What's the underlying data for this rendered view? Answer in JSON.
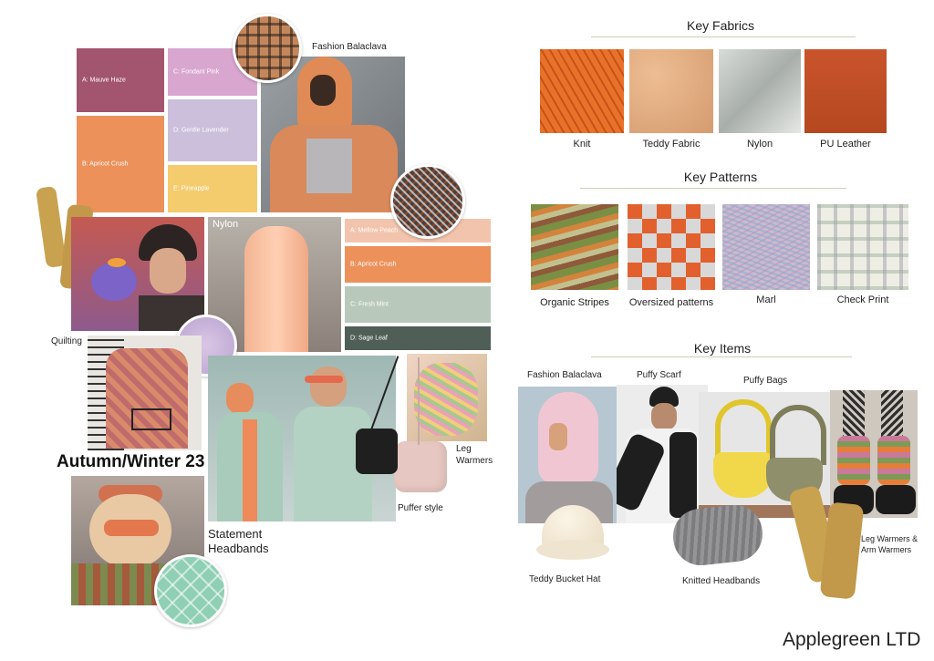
{
  "moodboard": {
    "title": "Autumn/Winter 23",
    "labels": {
      "balaclava": "Fashion Balaclava",
      "nylon": "Nylon",
      "quilting": "Quilting",
      "leg_warmers": "Leg\nWarmers",
      "puffer_style": "Puffer style",
      "statement_headbands": "Statement\nHeadbands"
    },
    "palette_left": [
      {
        "name": "A: Mauve Haze",
        "color": "#a3546f"
      },
      {
        "name": "B: Apricot Crush",
        "color": "#ec915a"
      },
      {
        "name": "C: Fondant Pink",
        "color": "#d9a6cf"
      },
      {
        "name": "D: Gentle Lavender",
        "color": "#cbbfdc"
      },
      {
        "name": "E: Pineapple",
        "color": "#f4cc6e"
      }
    ],
    "palette_right": [
      {
        "name": "A: Mellow Peach",
        "color": "#f2c4ad"
      },
      {
        "name": "B: Apricot Crush",
        "color": "#ec915a"
      },
      {
        "name": "C: Fresh Mint",
        "color": "#b8c9bb"
      },
      {
        "name": "D: Sage Leaf",
        "color": "#4f5f57"
      }
    ]
  },
  "key_fabrics": {
    "heading": "Key Fabrics",
    "items": [
      {
        "label": "Knit",
        "icon": "knit-texture"
      },
      {
        "label": "Teddy Fabric",
        "icon": "teddy-texture"
      },
      {
        "label": "Nylon",
        "icon": "nylon-texture"
      },
      {
        "label": "PU Leather",
        "icon": "leather-texture"
      }
    ]
  },
  "key_patterns": {
    "heading": "Key Patterns",
    "items": [
      {
        "label": "Organic Stripes"
      },
      {
        "label": "Oversized patterns"
      },
      {
        "label": "Marl"
      },
      {
        "label": "Check Print"
      }
    ]
  },
  "key_items": {
    "heading": "Key Items",
    "labels": {
      "balaclava": "Fashion Balaclava",
      "scarf": "Puffy Scarf",
      "bags": "Puffy Bags",
      "bucket_hat": "Teddy Bucket Hat",
      "headbands": "Knitted Headbands",
      "leg_arm": "Leg Warmers &\nArm Warmers"
    }
  },
  "brand": "Applegreen LTD"
}
